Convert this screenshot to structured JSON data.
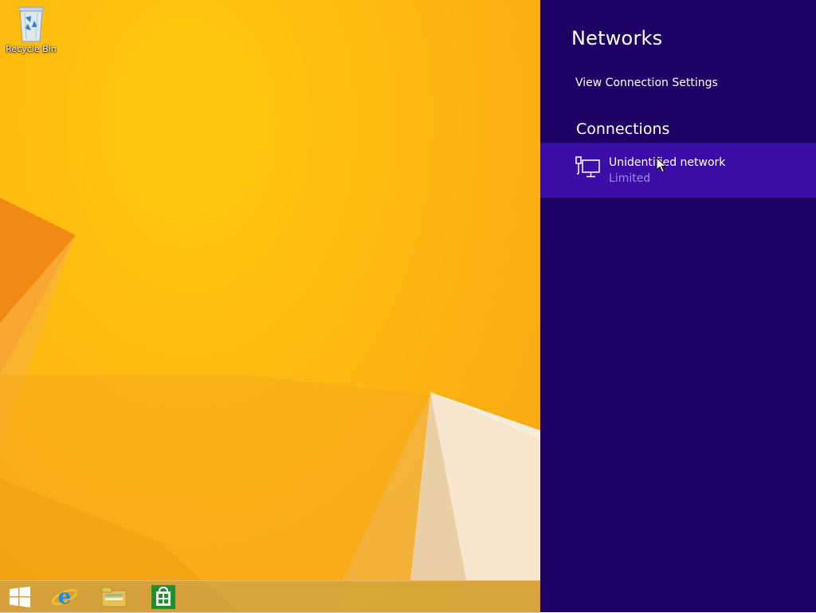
{
  "desktop": {
    "icons": [
      {
        "label": "Recycle Bin",
        "icon": "recycle-bin-icon"
      }
    ]
  },
  "taskbar": {
    "items": [
      {
        "icon": "windows-start-icon"
      },
      {
        "icon": "internet-explorer-icon"
      },
      {
        "icon": "file-explorer-icon"
      },
      {
        "icon": "store-icon"
      }
    ]
  },
  "networks_panel": {
    "title": "Networks",
    "view_settings_label": "View Connection Settings",
    "connections_heading": "Connections",
    "connections": [
      {
        "name": "Unidentified network",
        "status": "Limited",
        "icon": "wired-network-icon"
      }
    ]
  },
  "colors": {
    "panel_bg": "#1e0263",
    "selected_item_bg": "#3b0fa7",
    "desktop_bg": "#fdb811"
  }
}
